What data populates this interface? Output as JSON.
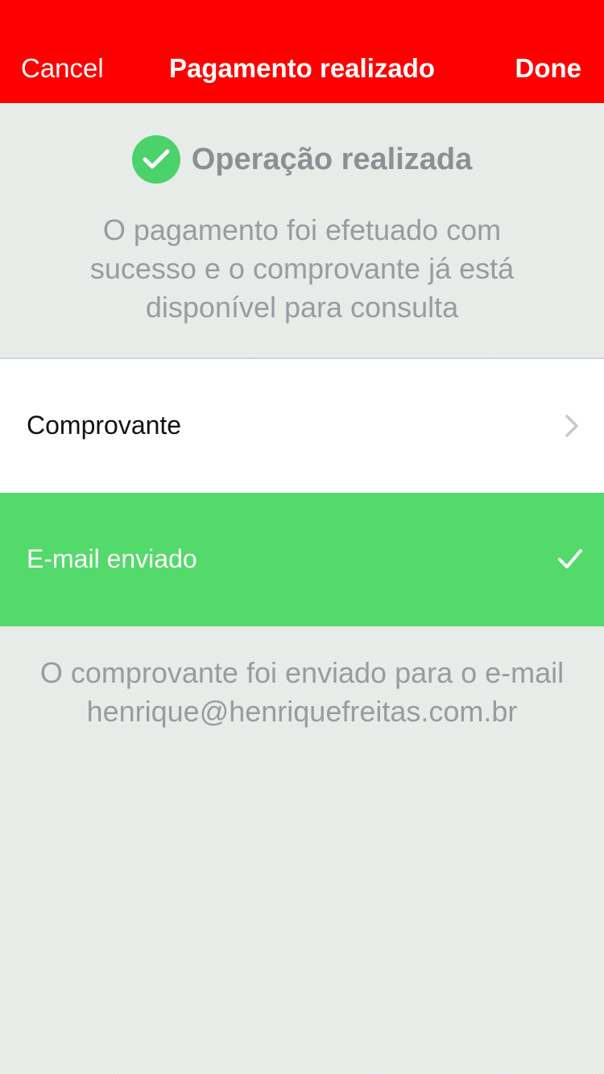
{
  "navbar": {
    "cancel_label": "Cancel",
    "title": "Pagamento realizado",
    "done_label": "Done",
    "background_color": "#ff0000"
  },
  "status": {
    "icon": "check-circle-icon",
    "title": "Operação realizada",
    "message": "O pagamento foi efetuado com sucesso e o comprovante já está disponível para consulta",
    "icon_color": "#4cd26b"
  },
  "options": {
    "receipt": {
      "label": "Comprovante",
      "icon": "chevron-right-icon"
    },
    "email": {
      "label": "E-mail enviado",
      "icon": "checkmark-icon",
      "background_color": "#54d96b"
    }
  },
  "footer": {
    "message": "O comprovante foi enviado para o e-mail henrique@henriquefreitas.com.br"
  }
}
